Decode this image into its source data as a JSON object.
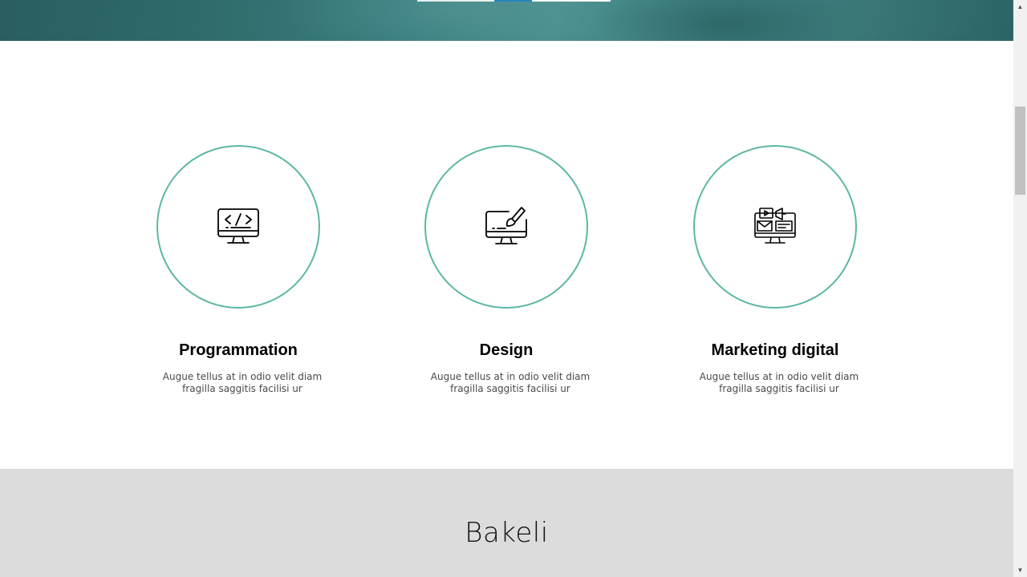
{
  "services": [
    {
      "icon": "code-monitor-icon",
      "title": "Programmation",
      "description_line1": "Augue tellus at in odio velit diam",
      "description_line2": "fragilla saggitis facilisi ur"
    },
    {
      "icon": "design-monitor-icon",
      "title": "Design",
      "description_line1": "Augue tellus at in odio velit diam",
      "description_line2": "fragilla saggitis facilisi ur"
    },
    {
      "icon": "marketing-monitor-icon",
      "title": "Marketing digital",
      "description_line1": "Augue tellus at in odio velit diam",
      "description_line2": "fragilla saggitis facilisi ur"
    }
  ],
  "bakeli": {
    "title": "Bakeli"
  },
  "colors": {
    "accent_circle": "#5cb7a4",
    "hero_teal": "#3a7e7f",
    "section_gray": "#dcdcdc"
  },
  "scrollbar": {
    "up_arrow": "▲",
    "down_arrow": "▼"
  }
}
